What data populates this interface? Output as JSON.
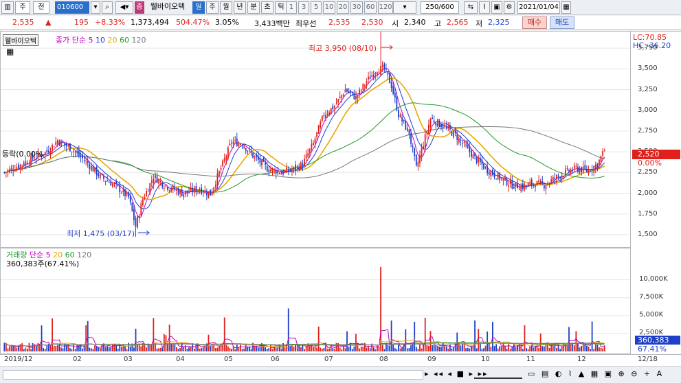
{
  "toolbar": {
    "market": "주",
    "prev": "전",
    "code": "010600",
    "stock_name": "웰바이오텍",
    "badge": "증",
    "periods": [
      "일",
      "주",
      "월",
      "년",
      "분",
      "초",
      "틱"
    ],
    "minutes": [
      "1",
      "3",
      "5",
      "10",
      "20",
      "30",
      "60",
      "120"
    ],
    "count": "250/600",
    "date": "2021/01/04"
  },
  "info": {
    "price": "2,535",
    "change": "195",
    "change_pct": "+8.33%",
    "volume": "1,373,494",
    "vol_ratio": "504.47%",
    "turnover": "3.05%",
    "amount": "3,433백만",
    "best_label": "최우선",
    "ask": "2,535",
    "bid": "2,530",
    "open_label": "시",
    "open": "2,340",
    "high_label": "고",
    "high": "2,565",
    "low_label": "저",
    "low": "2,325",
    "buy": "매수",
    "sell": "매도"
  },
  "price_pane": {
    "name_tab": "웰바이오텍",
    "legend_prefix": "종가 단순",
    "ma": [
      "5",
      "10",
      "20",
      "60",
      "120"
    ],
    "lc": "LC:70.85",
    "hc": "HC:-36.20",
    "high_note": "최고 3,950 (08/10)",
    "low_note": "최저 1,475 (03/17)",
    "left_tag": "등락(0.00%",
    "cur_price": "2,520",
    "cur_pct": "0.00%",
    "yticks": [
      "3,750",
      "3,500",
      "3,250",
      "3,000",
      "2,750",
      "2,500",
      "2,250",
      "2,000",
      "1,750",
      "1,500"
    ]
  },
  "vol_pane": {
    "title": "거래량",
    "legend_prefix": "단순",
    "ma": [
      "5",
      "20",
      "60",
      "120"
    ],
    "subtitle": "360,383주(67.41%)",
    "yticks": [
      "10,000K",
      "7,500K",
      "5,000K",
      "2,500K"
    ],
    "cur_vol": "360,383",
    "cur_pct": "67.41%"
  },
  "xaxis": [
    "2019/12",
    "02",
    "03",
    "04",
    "05",
    "06",
    "07",
    "08",
    "09",
    "10",
    "11",
    "12",
    "12/18"
  ],
  "colors": {
    "up": "#e0201b",
    "down": "#1e3fc7",
    "ma5": "#c000c0",
    "ma10": "#1e3fc7",
    "ma20": "#e8a800",
    "ma60": "#1f9a2f",
    "ma120": "#777777"
  },
  "chart_data": {
    "type": "candlestick",
    "title": "웰바이오텍",
    "ylim": [
      1400,
      3900
    ],
    "anchors": [
      [
        0,
        2250
      ],
      [
        8,
        2330
      ],
      [
        16,
        2420
      ],
      [
        24,
        2500
      ],
      [
        30,
        2640
      ],
      [
        38,
        2530
      ],
      [
        46,
        2380
      ],
      [
        54,
        2200
      ],
      [
        62,
        2100
      ],
      [
        70,
        1950
      ],
      [
        74,
        1600
      ],
      [
        78,
        1930
      ],
      [
        84,
        2200
      ],
      [
        90,
        2100
      ],
      [
        100,
        2000
      ],
      [
        110,
        2050
      ],
      [
        116,
        1990
      ],
      [
        122,
        2300
      ],
      [
        128,
        2620
      ],
      [
        134,
        2600
      ],
      [
        140,
        2450
      ],
      [
        148,
        2300
      ],
      [
        156,
        2250
      ],
      [
        162,
        2280
      ],
      [
        168,
        2350
      ],
      [
        174,
        2600
      ],
      [
        180,
        2950
      ],
      [
        186,
        3050
      ],
      [
        192,
        3250
      ],
      [
        198,
        3150
      ],
      [
        204,
        3350
      ],
      [
        210,
        3500
      ],
      [
        214,
        3500
      ],
      [
        218,
        3300
      ],
      [
        222,
        2950
      ],
      [
        228,
        2720
      ],
      [
        232,
        2300
      ],
      [
        236,
        2600
      ],
      [
        240,
        2900
      ],
      [
        248,
        2800
      ],
      [
        254,
        2700
      ],
      [
        260,
        2550
      ],
      [
        266,
        2400
      ],
      [
        272,
        2280
      ],
      [
        280,
        2170
      ],
      [
        286,
        2100
      ],
      [
        292,
        2080
      ],
      [
        298,
        2120
      ],
      [
        304,
        2100
      ],
      [
        310,
        2180
      ],
      [
        316,
        2250
      ],
      [
        322,
        2300
      ],
      [
        328,
        2270
      ],
      [
        334,
        2350
      ],
      [
        338,
        2520
      ]
    ]
  }
}
